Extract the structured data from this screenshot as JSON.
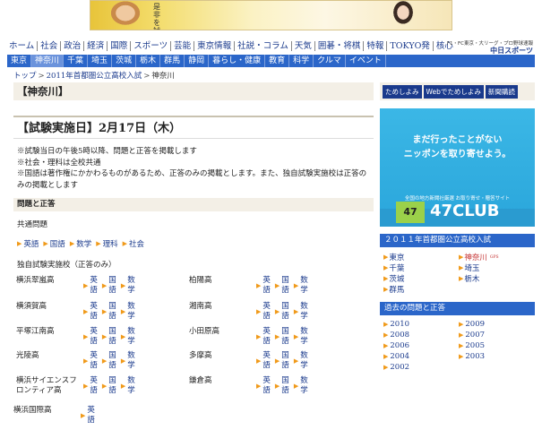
{
  "banner": {
    "text": "是非を試そう。"
  },
  "main_nav": [
    "ホーム",
    "社会",
    "政治",
    "経済",
    "国際",
    "スポーツ",
    "芸能",
    "東京情報",
    "社説・コラム",
    "天気",
    "囲碁・将棋",
    "特報",
    "TOKYO発",
    "核心"
  ],
  "brand": {
    "tagline": "F1・FC東京・大リーグ・プロ野球速報",
    "name": "中日スポーツ"
  },
  "sub_nav": [
    "東京",
    "神奈川",
    "千葉",
    "埼玉",
    "茨城",
    "栃木",
    "群馬",
    "静岡",
    "暮らし・健康",
    "教育",
    "科学",
    "クルマ",
    "イベント"
  ],
  "sub_nav_active": "神奈川",
  "breadcrumb": {
    "top": "トップ",
    "parent": "2011年首都圏公立高校入試",
    "current": "神奈川"
  },
  "page_title": "【神奈川】",
  "exam_date": "【試験実施日】2月17日（木）",
  "notes": [
    "※試験当日の午後5時以降、問題と正答を掲載します",
    "※社会・理科は全校共通",
    "※国語は著作権にかかわるものがあるため、正答のみの掲載とします。また、独自試験実施校は正答のみの掲載とします"
  ],
  "section_head": "問題と正答",
  "common_head": "共通問題",
  "common_links": [
    "英語",
    "国語",
    "数学",
    "理科",
    "社会"
  ],
  "independent_head": "独自試験実施校（正答のみ）",
  "schools": [
    {
      "name": "横浜翠嵐高",
      "links": [
        "英語",
        "国語",
        "数学"
      ]
    },
    {
      "name": "柏陽高",
      "links": [
        "英語",
        "国語",
        "数学"
      ]
    },
    {
      "name": "横須賀高",
      "links": [
        "英語",
        "国語",
        "数学"
      ]
    },
    {
      "name": "湘南高",
      "links": [
        "英語",
        "国語",
        "数学"
      ]
    },
    {
      "name": "平塚江南高",
      "links": [
        "英語",
        "国語",
        "数学"
      ]
    },
    {
      "name": "小田原高",
      "links": [
        "英語",
        "国語",
        "数学"
      ]
    },
    {
      "name": "光陵高",
      "links": [
        "英語",
        "国語",
        "数学"
      ]
    },
    {
      "name": "多摩高",
      "links": [
        "英語",
        "国語",
        "数学"
      ]
    },
    {
      "name": "横浜サイエンスフロンティア高",
      "links": [
        "英語",
        "国語",
        "数学"
      ]
    },
    {
      "name": "鎌倉高",
      "links": [
        "英語",
        "国語",
        "数学"
      ]
    },
    {
      "name": "横浜国際高",
      "links": [
        "英語"
      ]
    }
  ],
  "right_buttons": [
    "ためしよみ",
    "Webでためしよみ",
    "新聞購読"
  ],
  "ad": {
    "line1": "まだ行ったことがない",
    "line2": "ニッポンを取り寄せよう。",
    "tiny": "全国の地方新聞社厳選 お取り寄せ・贈答サイト",
    "logo": "47",
    "club": "47CLUB"
  },
  "exam_box": {
    "header": "２０１１年首都圏公立高校入試",
    "items": [
      "東京",
      "神奈川",
      "千葉",
      "埼玉",
      "茨城",
      "栃木",
      "群馬"
    ],
    "active": "神奈川",
    "active_badge": "GPS"
  },
  "past_box": {
    "header": "過去の問題と正答",
    "items": [
      "2010",
      "2009",
      "2008",
      "2007",
      "2006",
      "2005",
      "2004",
      "2003",
      "2002"
    ]
  }
}
